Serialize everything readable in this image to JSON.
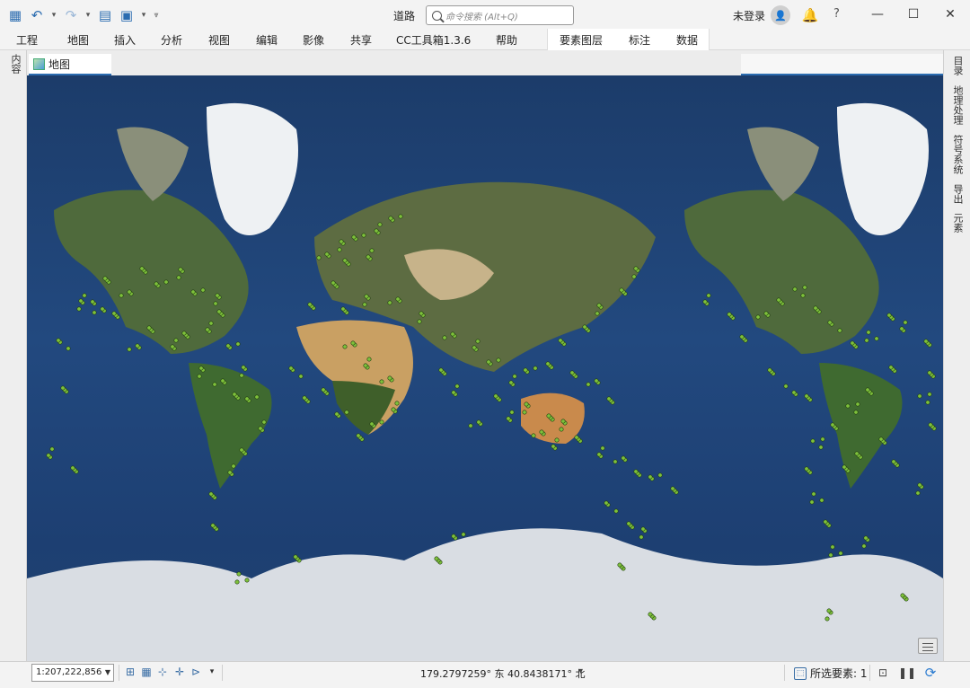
{
  "titlebar": {
    "document_title": "道路",
    "search_placeholder": "命令搜索 (Alt+Q)",
    "signin_label": "未登录",
    "help_label": "?"
  },
  "ribbon": {
    "tabs": [
      "工程",
      "地图",
      "插入",
      "分析",
      "视图",
      "编辑",
      "影像",
      "共享",
      "CC工具箱1.3.6",
      "帮助"
    ],
    "contextual_tabs": [
      "要素图层",
      "标注",
      "数据"
    ]
  },
  "left_panel": {
    "label": "内容"
  },
  "view": {
    "tab_title": "地图"
  },
  "right_panels": [
    "目录",
    "地理处理",
    "符号系统",
    "导出",
    "元素"
  ],
  "map": {
    "point_color": "#7ec13b",
    "point_outline": "#1e3a10",
    "ocean_color": "#1b3a6b"
  },
  "statusbar": {
    "scale": "1:207,222,856",
    "coordinates": "179.2797259° 东 40.8438171° 北",
    "selected_features_label": "所选要素: 1"
  },
  "colors": {
    "accent": "#2b6cb0",
    "notify": "#1e6fd1"
  }
}
